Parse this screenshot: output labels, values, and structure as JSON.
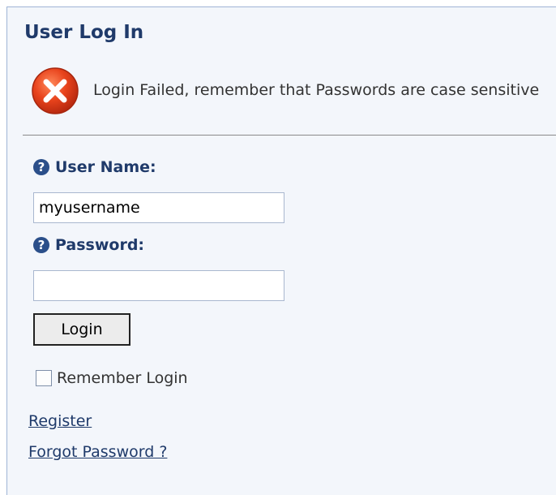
{
  "panel": {
    "title": "User Log In"
  },
  "error": {
    "message": "Login Failed, remember that Passwords are case sensitive",
    "icon": "error-x-icon"
  },
  "form": {
    "username": {
      "label": "User Name:",
      "value": "myusername",
      "icon": "help-icon"
    },
    "password": {
      "label": "Password:",
      "value": "",
      "icon": "help-icon"
    },
    "login_label": "Login",
    "remember_label": "Remember Login",
    "remember_checked": false
  },
  "links": {
    "register": "Register",
    "forgot_password": "Forgot Password ?"
  },
  "colors": {
    "panel_background": "#f3f6fb",
    "heading": "#1f3a6a",
    "error_red": "#e2401f"
  }
}
